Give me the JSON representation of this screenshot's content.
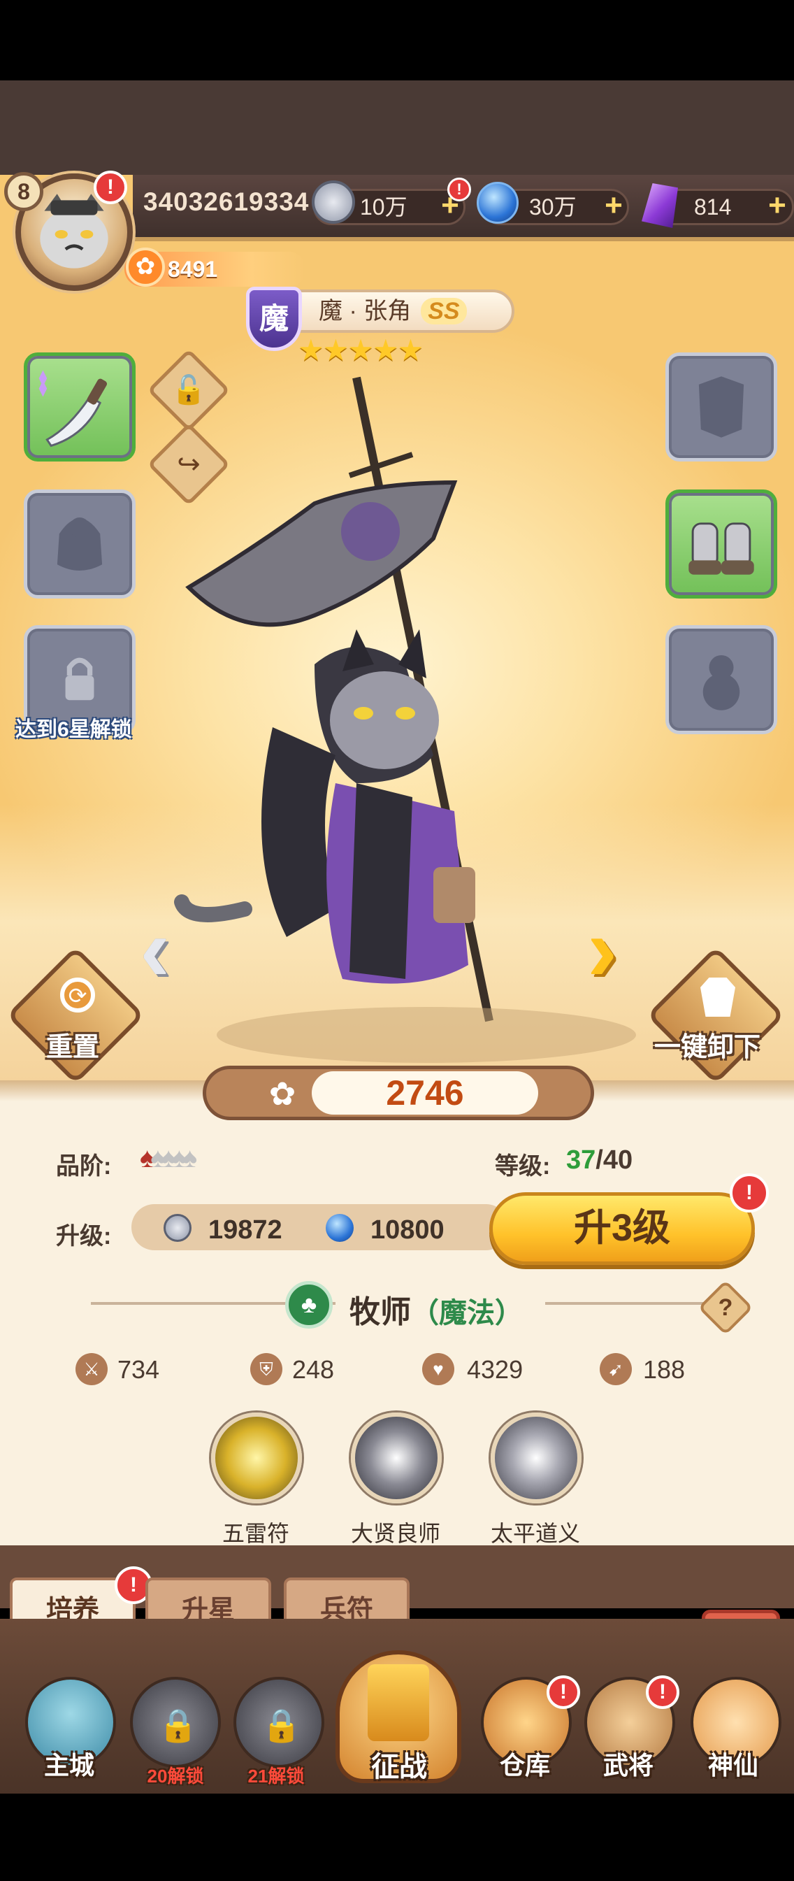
{
  "player": {
    "level": "8",
    "uid": "34032619334",
    "paw_points": "8491"
  },
  "resources": {
    "coins": "10万",
    "orbs": "30万",
    "gems": "814"
  },
  "hero": {
    "faction_badge": "魔",
    "name": "魔 · 张角",
    "rarity": "SS",
    "stars": "★★★★★",
    "star_count": 5
  },
  "gear": {
    "unlock_hint": "达到6星解锁"
  },
  "actions": {
    "reset_label": "重置",
    "unequip_all_label": "一键卸下"
  },
  "power": "2746",
  "stats_panel": {
    "grade_label": "品阶:",
    "level_label": "等级:",
    "level_current": "37",
    "level_max": "/40",
    "upgrade_label": "升级:",
    "upgrade_coin_cost": "19872",
    "upgrade_orb_cost": "10800",
    "upgrade_button": "升3级",
    "class_name": "牧师",
    "class_type": "（魔法）",
    "help": "?",
    "attack": "734",
    "defense": "248",
    "hp": "4329",
    "speed": "188"
  },
  "skills": [
    {
      "name": "五雷符",
      "color": "#e0c23a"
    },
    {
      "name": "大贤良师",
      "color": "#7c7c86"
    },
    {
      "name": "太平道义",
      "color": "#9a9aa6"
    }
  ],
  "tabs": [
    {
      "label": "培养",
      "active": true
    },
    {
      "label": "升星",
      "active": false
    },
    {
      "label": "兵符",
      "active": false
    }
  ],
  "nav": {
    "main_city": "主城",
    "locked1": "20解锁",
    "locked2": "21解锁",
    "battle": "征战",
    "warehouse": "仓库",
    "generals": "武将",
    "immortal": "神仙"
  },
  "alert_mark": "!",
  "colors": {
    "accent_gold": "#ffc22a",
    "level_green": "#2e9d3a",
    "power_text": "#c24b13",
    "class_purple": "#2e8a4a"
  }
}
